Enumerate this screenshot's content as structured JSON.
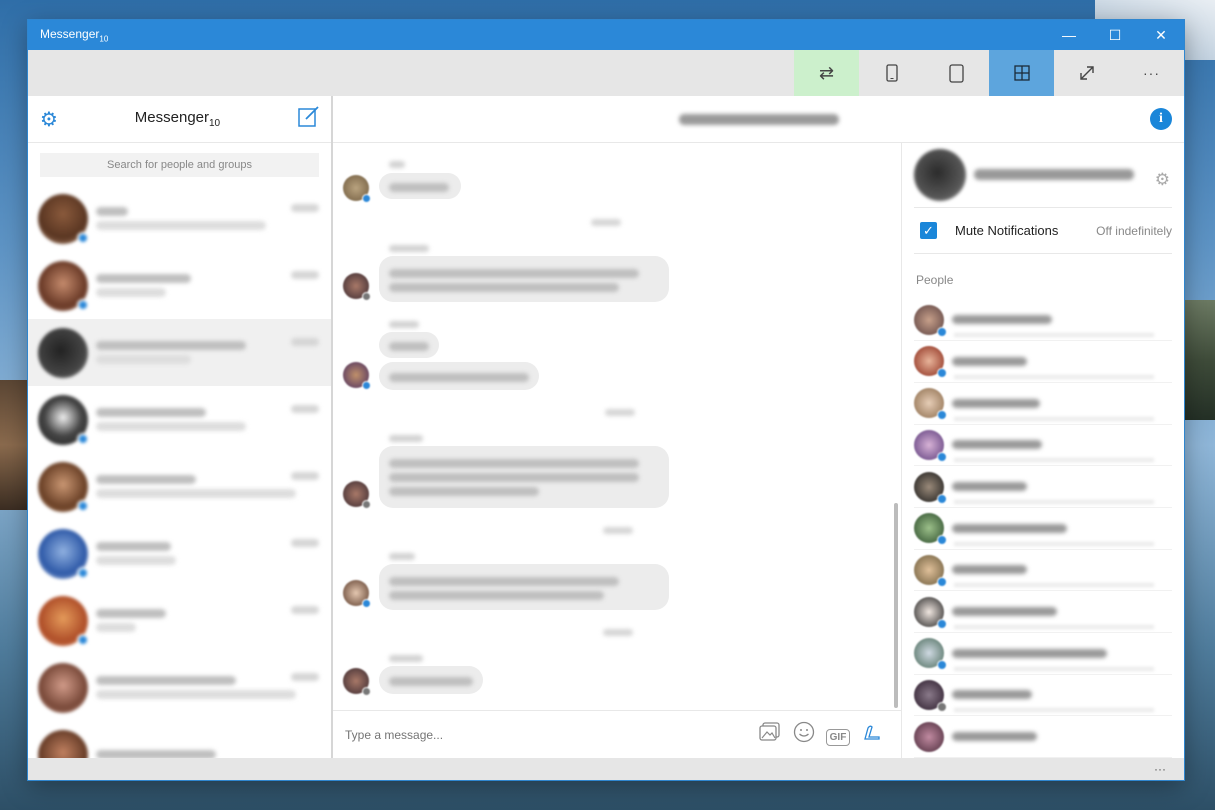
{
  "window": {
    "title": "Messenger",
    "title_sub": "10"
  },
  "toolbar": {
    "buttons": [
      {
        "name": "swap-icon",
        "glyph": "⇄",
        "state": "green"
      },
      {
        "name": "phone-icon",
        "glyph": "▯",
        "state": ""
      },
      {
        "name": "tablet-icon",
        "glyph": "▢",
        "state": ""
      },
      {
        "name": "grid-icon",
        "glyph": "⊞",
        "state": "blue"
      },
      {
        "name": "fullscreen-icon",
        "glyph": "⤢",
        "state": ""
      },
      {
        "name": "more-icon",
        "glyph": "···",
        "state": ""
      }
    ]
  },
  "sidebar": {
    "title": "Messenger",
    "title_sub": "10",
    "search_placeholder": "Search for people and groups"
  },
  "composer": {
    "placeholder": "Type a message...",
    "gif_label": "GIF"
  },
  "info_panel": {
    "mute_label": "Mute Notifications",
    "mute_value": "Off indefinitely",
    "people_heading": "People"
  },
  "colors": {
    "accent": "#2b88d8",
    "toolbar_green": "#ccf0cc",
    "toolbar_blue": "#5da5dd"
  }
}
